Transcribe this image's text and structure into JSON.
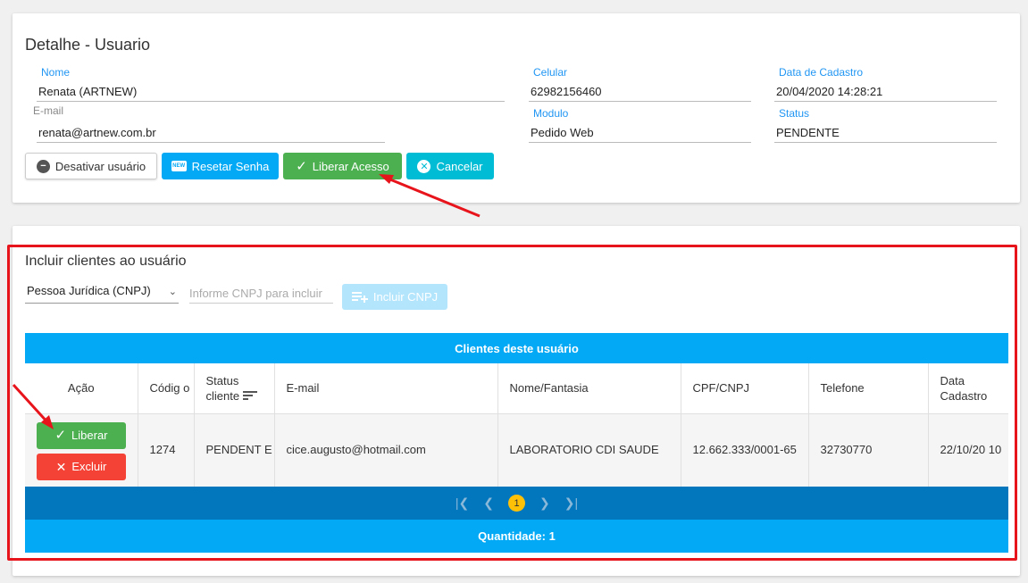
{
  "detail": {
    "title": "Detalhe - Usuario",
    "fields": {
      "nome": {
        "label": "Nome",
        "value": "Renata (ARTNEW)"
      },
      "email": {
        "label": "E-mail",
        "value": "renata@artnew.com.br"
      },
      "celular": {
        "label": "Celular",
        "value": "62982156460"
      },
      "modulo": {
        "label": "Modulo",
        "value": "Pedido Web"
      },
      "data_cadastro": {
        "label": "Data de Cadastro",
        "value": "20/04/2020 14:28:21"
      },
      "status": {
        "label": "Status",
        "value": "PENDENTE"
      }
    },
    "buttons": {
      "desativar": "Desativar usuário",
      "resetar": "Resetar Senha",
      "resetar_badge": "NEW",
      "liberar": "Liberar Acesso",
      "cancelar": "Cancelar"
    }
  },
  "clientes": {
    "title": "Incluir clientes ao usuário",
    "select_value": "Pessoa Jurídica (CNPJ)",
    "cnpj_placeholder": "Informe CNPJ para incluir",
    "incluir_label": "Incluir CNPJ",
    "table_title": "Clientes deste usuário",
    "columns": {
      "acao": "Ação",
      "codigo": "Códig o",
      "status": "Status cliente",
      "email": "E-mail",
      "nome": "Nome/Fantasia",
      "cpf": "CPF/CNPJ",
      "telefone": "Telefone",
      "data": "Data Cadastro"
    },
    "rows": [
      {
        "liberar": "Liberar",
        "excluir": "Excluir",
        "codigo": "1274",
        "status": "PENDENT E",
        "email": "cice.augusto@hotmail.com",
        "nome": "LABORATORIO CDI SAUDE",
        "cpf": "12.662.333/0001-65",
        "telefone": "32730770",
        "data": "22/10/20 10"
      }
    ],
    "pagination": {
      "current": "1"
    },
    "quantidade": "Quantidade: 1"
  },
  "colors": {
    "accent": "#03a9f4",
    "success": "#4caf50",
    "danger": "#f44336",
    "highlight": "#e8141c",
    "page_current": "#ffc107"
  }
}
